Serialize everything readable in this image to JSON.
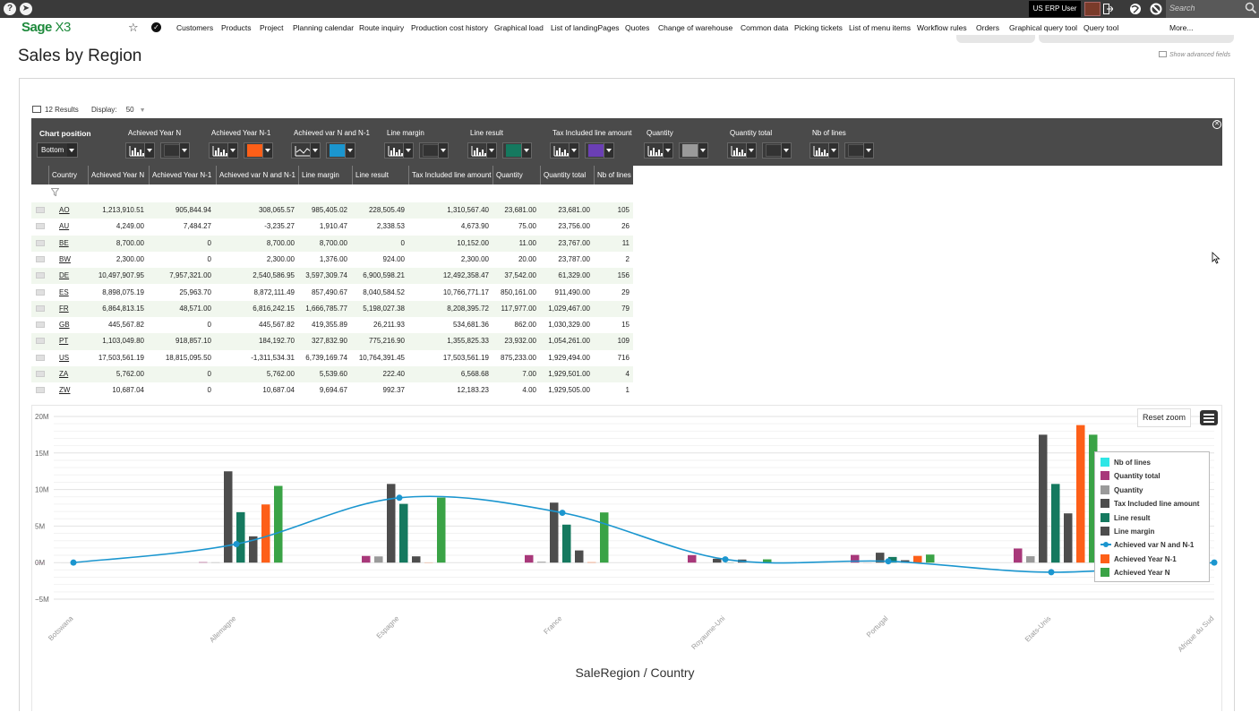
{
  "topbar": {
    "user": "US ERP User",
    "search_placeholder": "Search"
  },
  "nav": {
    "logo_brand": "Sage",
    "logo_product": "X3",
    "items": [
      "Customers",
      "Products",
      "Project",
      "Planning calendar",
      "Route inquiry",
      "Production cost history",
      "Graphical load",
      "List of landingPages",
      "Quotes",
      "Change of warehouse",
      "Common data",
      "Picking tickets",
      "List of menu items",
      "Workflow rules",
      "Orders",
      "Graphical query tool",
      "Query tool",
      "More..."
    ]
  },
  "page": {
    "title": "Sales by Region",
    "advanced_fields": "Show advanced fields"
  },
  "results": {
    "count": "12 Results",
    "display_label": "Display:",
    "display_value": "50"
  },
  "config": {
    "chart_position_label": "Chart position",
    "chart_position_value": "Bottom",
    "series": [
      {
        "label": "Achieved Year N",
        "chart": "bar",
        "color": ""
      },
      {
        "label": "Achieved Year N-1",
        "chart": "bar",
        "color": "#fd5f18"
      },
      {
        "label": "Achieved var N and N-1",
        "chart": "line",
        "color": "#1b96cf"
      },
      {
        "label": "Line margin",
        "chart": "bar",
        "color": ""
      },
      {
        "label": "Line result",
        "chart": "bar",
        "color": "#15795f"
      },
      {
        "label": "Tax Included line amount",
        "chart": "bar",
        "color": "#6b3fb5"
      },
      {
        "label": "Quantity",
        "chart": "bar",
        "color": "#9a9a9a"
      },
      {
        "label": "Quantity total",
        "chart": "bar",
        "color": ""
      },
      {
        "label": "Nb of lines",
        "chart": "bar",
        "color": ""
      }
    ]
  },
  "table": {
    "columns": [
      "Country",
      "Achieved Year N",
      "Achieved Year N-1",
      "Achieved var N and N-1",
      "Line margin",
      "Line result",
      "Tax Included line amount",
      "Quantity",
      "Quantity total",
      "Nb of lines"
    ],
    "rows": [
      [
        "AO",
        "1,213,910.51",
        "905,844.94",
        "308,065.57",
        "985,405.02",
        "228,505.49",
        "1,310,567.40",
        "23,681.00",
        "23,681.00",
        "105"
      ],
      [
        "AU",
        "4,249.00",
        "7,484.27",
        "-3,235.27",
        "1,910.47",
        "2,338.53",
        "4,673.90",
        "75.00",
        "23,756.00",
        "26"
      ],
      [
        "BE",
        "8,700.00",
        "0",
        "8,700.00",
        "8,700.00",
        "0",
        "10,152.00",
        "11.00",
        "23,767.00",
        "11"
      ],
      [
        "BW",
        "2,300.00",
        "0",
        "2,300.00",
        "1,376.00",
        "924.00",
        "2,300.00",
        "20.00",
        "23,787.00",
        "2"
      ],
      [
        "DE",
        "10,497,907.95",
        "7,957,321.00",
        "2,540,586.95",
        "3,597,309.74",
        "6,900,598.21",
        "12,492,358.47",
        "37,542.00",
        "61,329.00",
        "156"
      ],
      [
        "ES",
        "8,898,075.19",
        "25,963.70",
        "8,872,111.49",
        "857,490.67",
        "8,040,584.52",
        "10,766,771.17",
        "850,161.00",
        "911,490.00",
        "29"
      ],
      [
        "FR",
        "6,864,813.15",
        "48,571.00",
        "6,816,242.15",
        "1,666,785.77",
        "5,198,027.38",
        "8,208,395.72",
        "117,977.00",
        "1,029,467.00",
        "79"
      ],
      [
        "GB",
        "445,567.82",
        "0",
        "445,567.82",
        "419,355.89",
        "26,211.93",
        "534,681.36",
        "862.00",
        "1,030,329.00",
        "15"
      ],
      [
        "PT",
        "1,103,049.80",
        "918,857.10",
        "184,192.70",
        "327,832.90",
        "775,216.90",
        "1,355,825.33",
        "23,932.00",
        "1,054,261.00",
        "109"
      ],
      [
        "US",
        "17,503,561.19",
        "18,815,095.50",
        "-1,311,534.31",
        "6,739,169.74",
        "10,764,391.45",
        "17,503,561.19",
        "875,233.00",
        "1,929,494.00",
        "716"
      ],
      [
        "ZA",
        "5,762.00",
        "0",
        "5,762.00",
        "5,539.60",
        "222.40",
        "6,568.68",
        "7.00",
        "1,929,501.00",
        "4"
      ],
      [
        "ZW",
        "10,687.04",
        "0",
        "10,687.04",
        "9,694.67",
        "992.37",
        "12,183.23",
        "4.00",
        "1,929,505.00",
        "1"
      ]
    ]
  },
  "chart": {
    "reset_zoom": "Reset zoom",
    "xlabel": "SaleRegion / Country"
  },
  "chart_data": {
    "type": "bar",
    "categories": [
      "Botswana",
      "Allemagne",
      "Espagne",
      "France",
      "Royaume-Uni",
      "Portugal",
      "Etats-Unis",
      "Afrique du Sud"
    ],
    "xlabel": "SaleRegion / Country",
    "ylabel": "",
    "yticks": [
      "20M",
      "15M",
      "10M",
      "5M",
      "0M",
      "−5M"
    ],
    "ylim": [
      -5000000,
      20000000
    ],
    "legend_position": "right",
    "grid": true,
    "series": [
      {
        "name": "Nb of lines",
        "type": "bar",
        "color": "#2fe6e6",
        "values": [
          2,
          156,
          29,
          79,
          15,
          109,
          716,
          4
        ]
      },
      {
        "name": "Quantity total",
        "type": "bar",
        "color": "#a8387a",
        "values": [
          23787,
          61329,
          911490,
          1029467,
          1030329,
          1054261,
          1929494,
          1929501
        ]
      },
      {
        "name": "Quantity",
        "type": "bar",
        "color": "#9a9a9a",
        "values": [
          20,
          37542,
          850161,
          117977,
          862,
          23932,
          875233,
          7
        ]
      },
      {
        "name": "Tax Included line amount",
        "type": "bar",
        "color": "#4d4d4d",
        "values": [
          2300,
          12492358.47,
          10766771.17,
          8208395.72,
          534681.36,
          1355825.33,
          17503561.19,
          6568.68
        ]
      },
      {
        "name": "Line result",
        "type": "bar",
        "color": "#15795f",
        "values": [
          924,
          6900598.21,
          8040584.52,
          5198027.38,
          26211.93,
          775216.9,
          10764391.45,
          222.4
        ]
      },
      {
        "name": "Line margin",
        "type": "bar",
        "color": "#4d4d4d",
        "values": [
          1376,
          3597309.74,
          857490.67,
          1666785.77,
          419355.89,
          327832.9,
          6739169.74,
          5539.6
        ]
      },
      {
        "name": "Achieved var N and N-1",
        "type": "line",
        "color": "#1b96cf",
        "values": [
          2300,
          2540586.95,
          8872111.49,
          6816242.15,
          445567.82,
          184192.7,
          -1311534.31,
          5762
        ]
      },
      {
        "name": "Achieved Year N-1",
        "type": "bar",
        "color": "#fd5f18",
        "values": [
          0,
          7957321,
          25963.7,
          48571,
          0,
          918857.1,
          18815095.5,
          0
        ]
      },
      {
        "name": "Achieved Year N",
        "type": "bar",
        "color": "#3aa346",
        "values": [
          2300,
          10497907.95,
          8898075.19,
          6864813.15,
          445567.82,
          1103049.8,
          17503561.19,
          5762
        ]
      }
    ]
  }
}
